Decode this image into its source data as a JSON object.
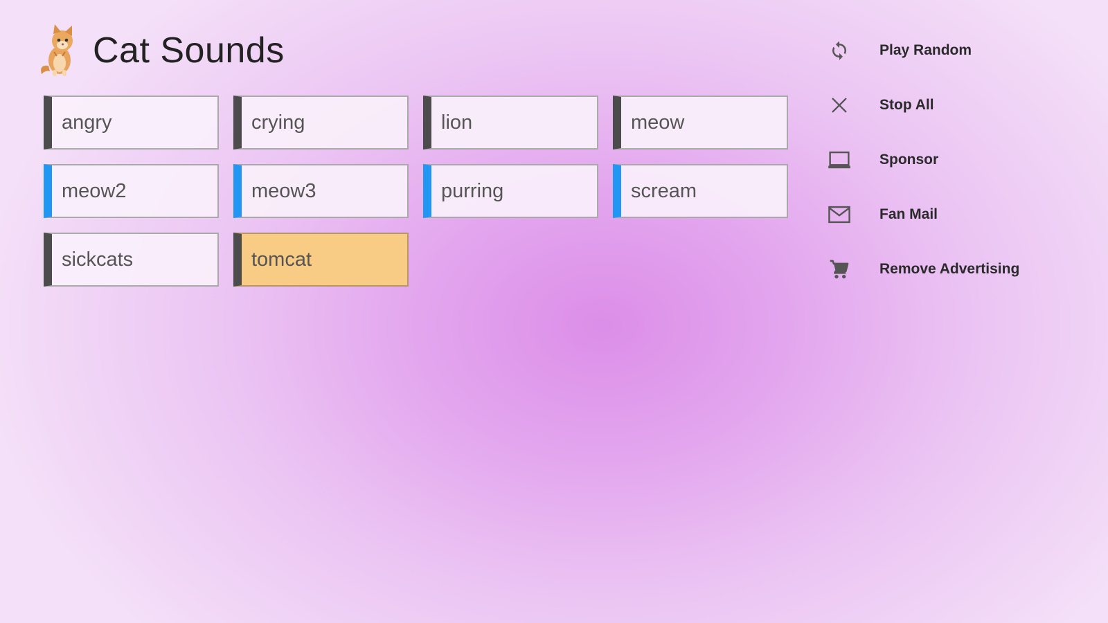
{
  "app": {
    "title": "Cat Sounds",
    "logo_icon": "kitten-logo-icon"
  },
  "sounds": [
    {
      "label": "angry",
      "accent": "#4c4c4c"
    },
    {
      "label": "crying",
      "accent": "#4c4c4c"
    },
    {
      "label": "lion",
      "accent": "#4c4c4c"
    },
    {
      "label": "meow",
      "accent": "#4c4c4c"
    },
    {
      "label": "meow2",
      "accent": "#2196f3"
    },
    {
      "label": "meow3",
      "accent": "#2196f3"
    },
    {
      "label": "purring",
      "accent": "#2196f3"
    },
    {
      "label": "scream",
      "accent": "#2196f3"
    },
    {
      "label": "sickcats",
      "accent": "#4c4c4c"
    },
    {
      "label": "tomcat",
      "accent": "#4c4c4c",
      "active": true,
      "active_color": "#f9cc86"
    }
  ],
  "menu": [
    {
      "label": "Play Random",
      "icon": "refresh-icon"
    },
    {
      "label": "Stop All",
      "icon": "close-icon"
    },
    {
      "label": "Sponsor",
      "icon": "laptop-icon"
    },
    {
      "label": "Fan Mail",
      "icon": "mail-icon"
    },
    {
      "label": "Remove Advertising",
      "icon": "cart-icon"
    }
  ]
}
